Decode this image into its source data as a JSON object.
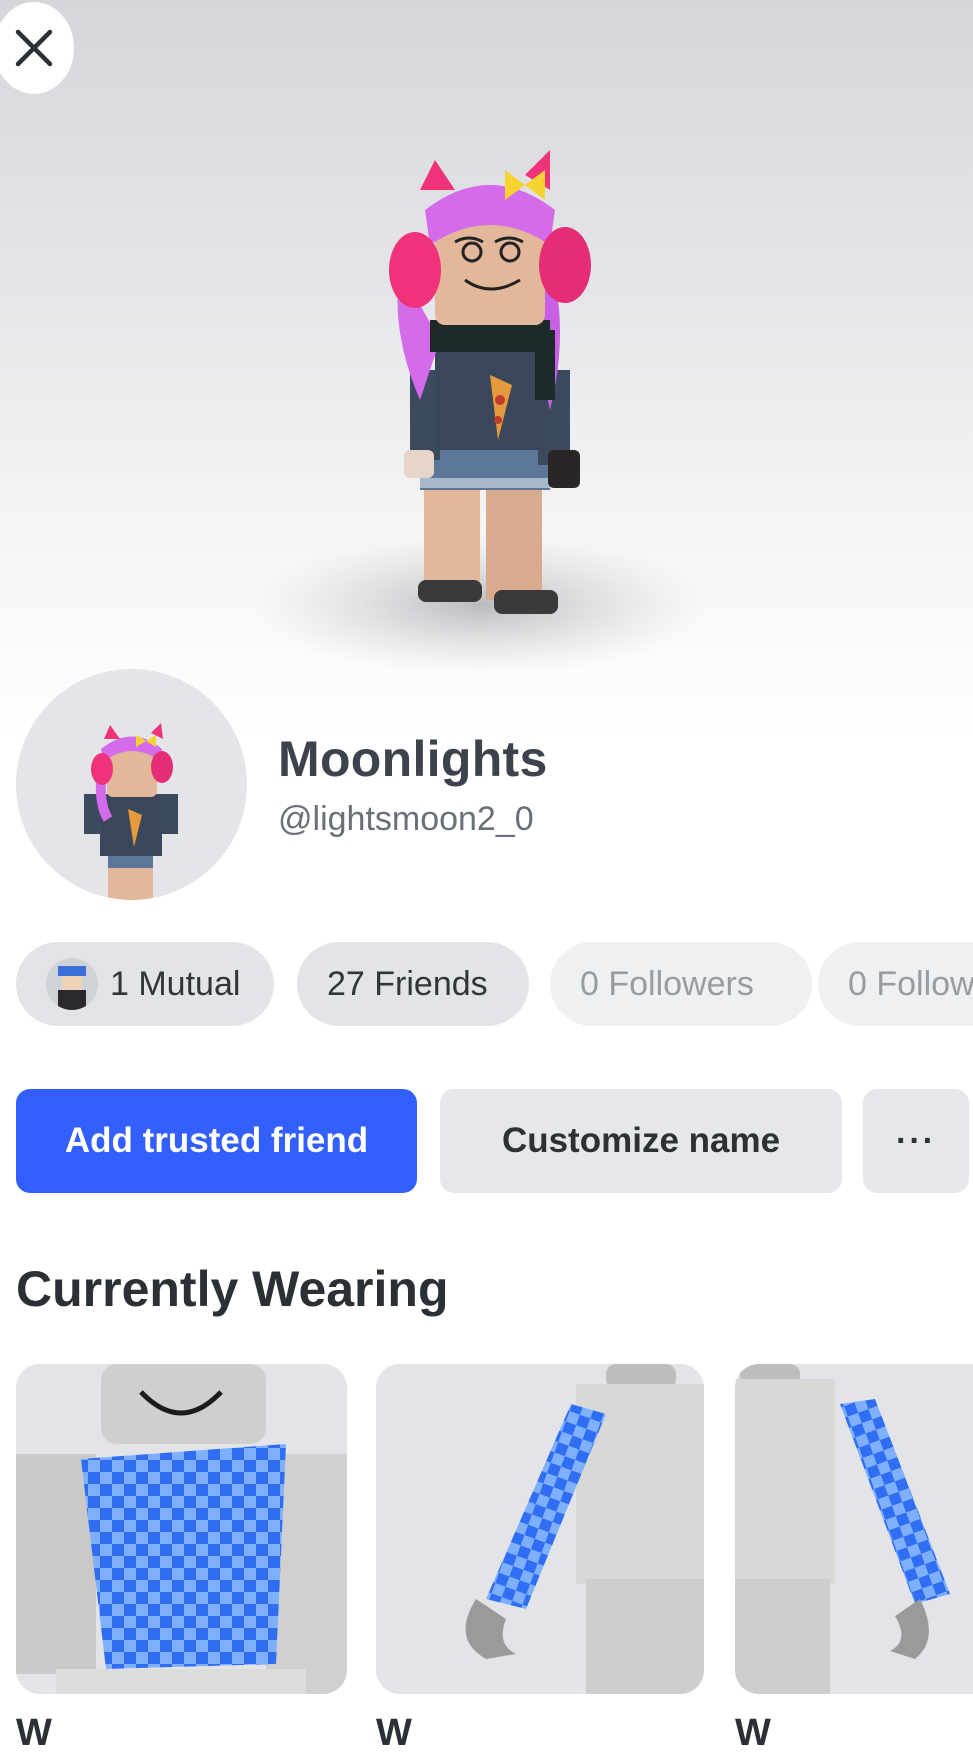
{
  "close_icon": "close-icon",
  "profile": {
    "display_name": "Moonlights",
    "username": "@lightsmoon2_0"
  },
  "stats": [
    {
      "label": "1 Mutual",
      "style": "strong"
    },
    {
      "label": "27 Friends",
      "style": "strong"
    },
    {
      "label": "0 Followers",
      "style": "muted"
    },
    {
      "label": "0 Follow",
      "style": "muted"
    }
  ],
  "actions": {
    "add_trusted_friend": "Add trusted friend",
    "customize_name": "Customize name",
    "more": "···"
  },
  "currently_wearing": {
    "title": "Currently Wearing",
    "items": [
      {
        "label": "W"
      },
      {
        "label": "W"
      },
      {
        "label": "W"
      }
    ]
  },
  "colors": {
    "primary_button": "#335fff",
    "pill_background": "#e3e4e7",
    "card_background": "#e3e4e7",
    "checker_blue": "#2f6df2",
    "checker_light": "#7fb0ff",
    "hair_pink": "#d36bea",
    "headphone_pink": "#f0327b"
  }
}
